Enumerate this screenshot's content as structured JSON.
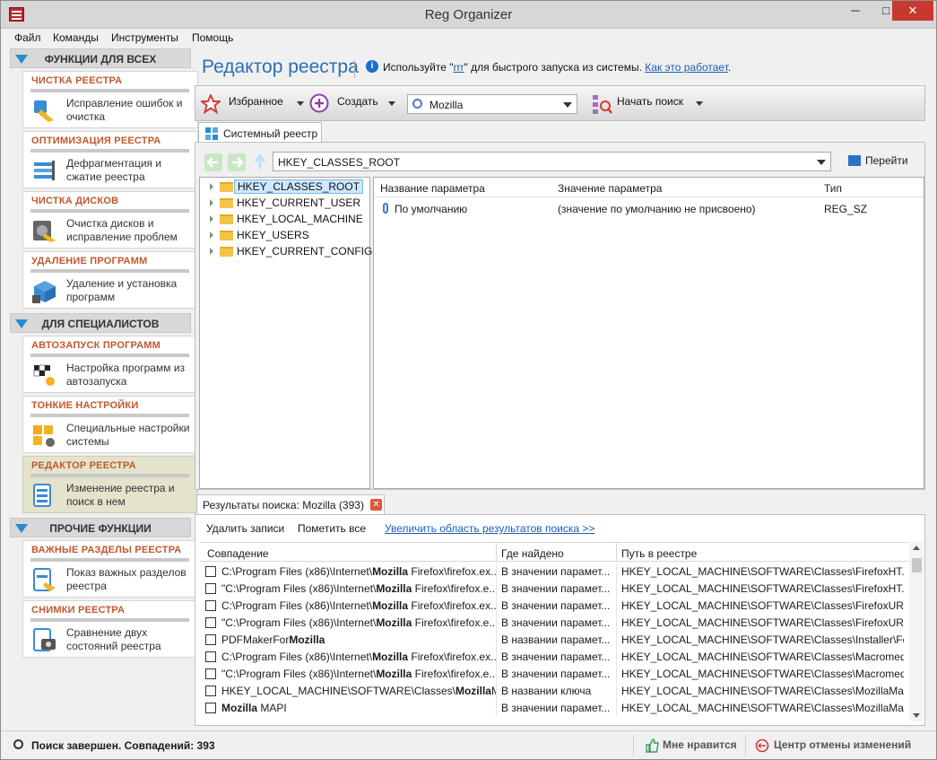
{
  "window": {
    "title": "Reg Organizer",
    "min": "─",
    "max": "□",
    "close": "✕"
  },
  "menu": [
    "Файл",
    "Команды",
    "Инструменты",
    "Помощь"
  ],
  "sidebar": {
    "sections": [
      {
        "title": "ФУНКЦИИ ДЛЯ ВСЕХ",
        "items": [
          {
            "title": "ЧИСТКА РЕЕСТРА",
            "desc": "Исправление ошибок и очистка",
            "icon": "broom-icon"
          },
          {
            "title": "ОПТИМИЗАЦИЯ РЕЕСТРА",
            "desc": "Дефрагментация и сжатие реестра",
            "icon": "compress-icon"
          },
          {
            "title": "ЧИСТКА ДИСКОВ",
            "desc": "Очистка дисков и исправление проблем",
            "icon": "disk-icon"
          },
          {
            "title": "УДАЛЕНИЕ ПРОГРАММ",
            "desc": "Удаление и установка программ",
            "icon": "uninstall-icon"
          }
        ]
      },
      {
        "title": "ДЛЯ СПЕЦИАЛИСТОВ",
        "items": [
          {
            "title": "АВТОЗАПУСК ПРОГРАММ",
            "desc": "Настройка программ из автозапуска",
            "icon": "flag-icon"
          },
          {
            "title": "ТОНКИЕ НАСТРОЙКИ",
            "desc": "Специальные настройки системы",
            "icon": "windows-gear-icon"
          },
          {
            "title": "РЕДАКТОР РЕЕСТРА",
            "desc": "Изменение реестра и поиск в нем",
            "icon": "registry-icon",
            "active": true
          }
        ]
      },
      {
        "title": "ПРОЧИЕ ФУНКЦИИ",
        "items": [
          {
            "title": "ВАЖНЫЕ РАЗДЕЛЫ РЕЕСТРА",
            "desc": "Показ важных разделов реестра",
            "icon": "important-keys-icon"
          },
          {
            "title": "СНИМКИ РЕЕСТРА",
            "desc": "Сравнение двух состояний реестра",
            "icon": "snapshot-icon"
          }
        ]
      }
    ]
  },
  "header": {
    "title": "Редактор реестра",
    "info_pre": "Используйте \"",
    "info_word": "rrr",
    "info_mid": "\" для быстрого запуска из системы. ",
    "info_link": "Как это работает",
    "info_post": "."
  },
  "toolbar": {
    "favorites": "Избранное",
    "create": "Создать",
    "search_value": "Mozilla",
    "start_search": "Начать поиск"
  },
  "tab": {
    "label": "Системный реестр"
  },
  "address": {
    "value": "HKEY_CLASSES_ROOT",
    "go": "Перейти"
  },
  "tree": [
    "HKEY_CLASSES_ROOT",
    "HKEY_CURRENT_USER",
    "HKEY_LOCAL_MACHINE",
    "HKEY_USERS",
    "HKEY_CURRENT_CONFIG"
  ],
  "values": {
    "headers": [
      "Название параметра",
      "Значение параметра",
      "Тип"
    ],
    "rows": [
      {
        "name": "По умолчанию",
        "value": "(значение по умолчанию не присвоено)",
        "type": "REG_SZ"
      }
    ]
  },
  "results": {
    "tab": "Результаты поиска: Mozilla (393)",
    "delete": "Удалить записи",
    "mark_all": "Пометить все",
    "enlarge": "Увеличить область результатов поиска >>",
    "headers": [
      "Совпадение",
      "Где найдено",
      "Путь в реестре"
    ],
    "rows": [
      {
        "pre": "C:\\Program Files (x86)\\Internet\\",
        "hl": "Mozilla",
        "post": " Firefox\\firefox.ex...",
        "where": "В значении парамет...",
        "path": "HKEY_LOCAL_MACHINE\\SOFTWARE\\Classes\\FirefoxHT..."
      },
      {
        "pre": "\"C:\\Program Files (x86)\\Internet\\",
        "hl": "Mozilla",
        "post": " Firefox\\firefox.e...",
        "where": "В значении парамет...",
        "path": "HKEY_LOCAL_MACHINE\\SOFTWARE\\Classes\\FirefoxHT..."
      },
      {
        "pre": "C:\\Program Files (x86)\\Internet\\",
        "hl": "Mozilla",
        "post": " Firefox\\firefox.ex...",
        "where": "В значении парамет...",
        "path": "HKEY_LOCAL_MACHINE\\SOFTWARE\\Classes\\FirefoxURL..."
      },
      {
        "pre": "\"C:\\Program Files (x86)\\Internet\\",
        "hl": "Mozilla",
        "post": " Firefox\\firefox.e...",
        "where": "В значении парамет...",
        "path": "HKEY_LOCAL_MACHINE\\SOFTWARE\\Classes\\FirefoxURL..."
      },
      {
        "pre": "PDFMakerFor",
        "hl": "Mozilla",
        "post": "",
        "where": "В названии парамет...",
        "path": "HKEY_LOCAL_MACHINE\\SOFTWARE\\Classes\\Installer\\Fe..."
      },
      {
        "pre": "C:\\Program Files (x86)\\Internet\\",
        "hl": "Mozilla",
        "post": " Firefox\\firefox.ex...",
        "where": "В значении парамет...",
        "path": "HKEY_LOCAL_MACHINE\\SOFTWARE\\Classes\\Macromed..."
      },
      {
        "pre": "\"C:\\Program Files (x86)\\Internet\\",
        "hl": "Mozilla",
        "post": " Firefox\\firefox.e...",
        "where": "В значении парамет...",
        "path": "HKEY_LOCAL_MACHINE\\SOFTWARE\\Classes\\Macromed..."
      },
      {
        "pre": "HKEY_LOCAL_MACHINE\\SOFTWARE\\Classes\\",
        "hl": "Mozilla",
        "post": "M...",
        "where": "В названии ключа",
        "path": "HKEY_LOCAL_MACHINE\\SOFTWARE\\Classes\\MozillaMapi"
      },
      {
        "pre": "",
        "hl": "Mozilla",
        "post": " MAPI",
        "where": "В значении парамет...",
        "path": "HKEY_LOCAL_MACHINE\\SOFTWARE\\Classes\\MozillaMa..."
      }
    ]
  },
  "status": {
    "text": "Поиск завершен. Совпадений: 393",
    "like": "Мне нравится",
    "undo": "Центр отмены изменений"
  },
  "colors": {
    "accent": "#2a8ad0",
    "card_title": "#c0582e",
    "active_card": "#e4e4cc"
  }
}
